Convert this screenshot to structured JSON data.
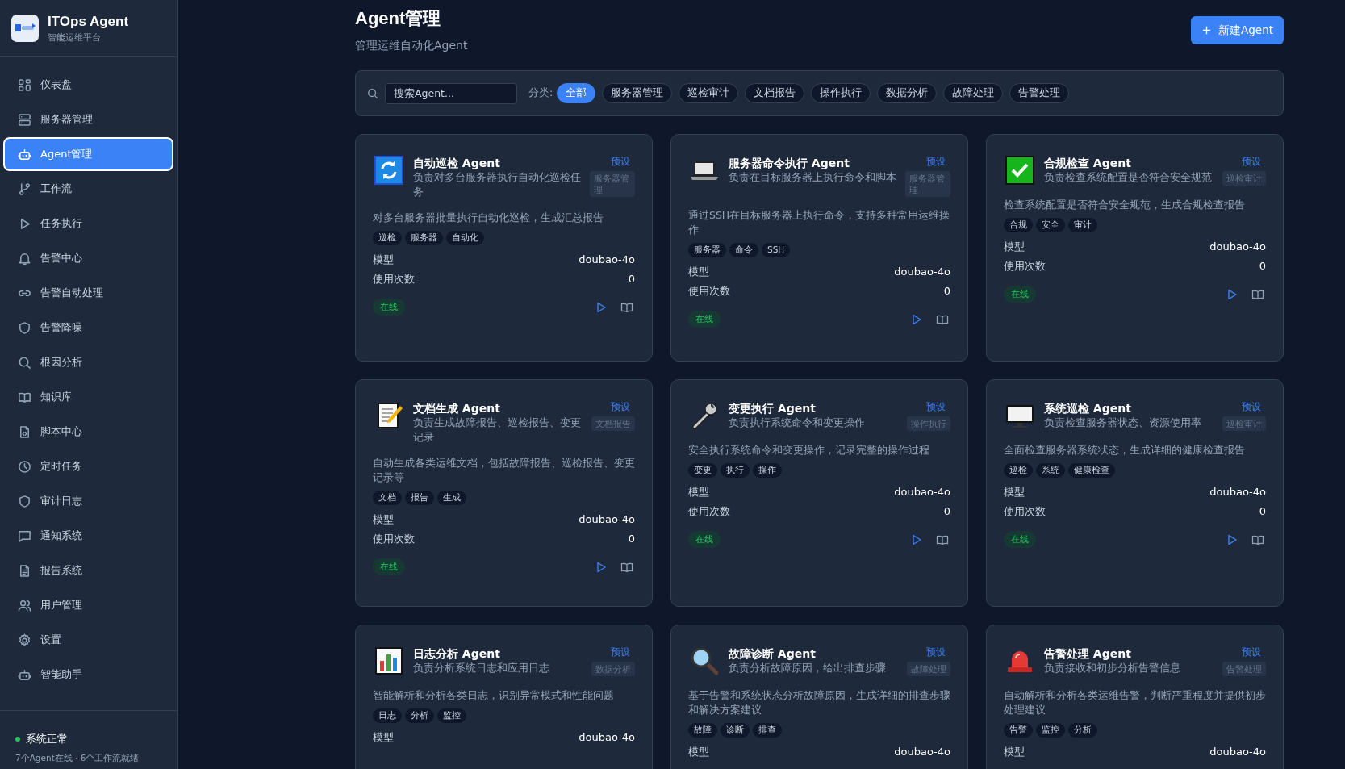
{
  "brand": {
    "title": "ITOps Agent",
    "subtitle": "智能运维平台"
  },
  "nav": [
    {
      "label": "仪表盘",
      "selected": false
    },
    {
      "label": "服务器管理",
      "selected": false
    },
    {
      "label": "Agent管理",
      "selected": true
    },
    {
      "label": "工作流",
      "selected": false
    },
    {
      "label": "任务执行",
      "selected": false
    },
    {
      "label": "告警中心",
      "selected": false
    },
    {
      "label": "告警自动处理",
      "selected": false
    },
    {
      "label": "告警降噪",
      "selected": false
    },
    {
      "label": "根因分析",
      "selected": false
    },
    {
      "label": "知识库",
      "selected": false
    },
    {
      "label": "脚本中心",
      "selected": false
    },
    {
      "label": "定时任务",
      "selected": false
    },
    {
      "label": "审计日志",
      "selected": false
    },
    {
      "label": "通知系统",
      "selected": false
    },
    {
      "label": "报告系统",
      "selected": false
    },
    {
      "label": "用户管理",
      "selected": false
    },
    {
      "label": "设置",
      "selected": false
    },
    {
      "label": "智能助手",
      "selected": false
    }
  ],
  "system_status": {
    "label": "系统正常",
    "detail": "7个Agent在线 · 6个工作流就绪",
    "color": "#22c55e"
  },
  "page": {
    "title": "Agent管理",
    "subtitle": "管理运维自动化Agent",
    "new_button": "新建Agent"
  },
  "filter": {
    "search_placeholder": "搜索Agent...",
    "category_label": "分类:",
    "categories": [
      {
        "label": "全部",
        "selected": true
      },
      {
        "label": "服务器管理",
        "selected": false
      },
      {
        "label": "巡检审计",
        "selected": false
      },
      {
        "label": "文档报告",
        "selected": false
      },
      {
        "label": "操作执行",
        "selected": false
      },
      {
        "label": "数据分析",
        "selected": false
      },
      {
        "label": "故障处理",
        "selected": false
      },
      {
        "label": "告警处理",
        "selected": false
      }
    ]
  },
  "agents": [
    {
      "name": "自动巡检 Agent",
      "summary": "负责对多台服务器执行自动化巡检任务",
      "preset": "预设",
      "category": "服务器管理",
      "description": "对多台服务器批量执行自动化巡检，生成汇总报告",
      "tags": [
        "巡检",
        "服务器",
        "自动化"
      ],
      "stats": [
        {
          "label": "模型",
          "value": "doubao-4o"
        },
        {
          "label": "使用次数",
          "value": "0"
        }
      ],
      "status": "在线"
    },
    {
      "name": "服务器命令执行 Agent",
      "summary": "负责在目标服务器上执行命令和脚本",
      "preset": "预设",
      "category": "服务器管理",
      "description": "通过SSH在目标服务器上执行命令，支持多种常用运维操作",
      "tags": [
        "服务器",
        "命令",
        "SSH"
      ],
      "stats": [
        {
          "label": "模型",
          "value": "doubao-4o"
        },
        {
          "label": "使用次数",
          "value": "0"
        }
      ],
      "status": "在线"
    },
    {
      "name": "合规检查 Agent",
      "summary": "负责检查系统配置是否符合安全规范",
      "preset": "预设",
      "category": "巡检审计",
      "description": "检查系统配置是否符合安全规范，生成合规检查报告",
      "tags": [
        "合规",
        "安全",
        "审计"
      ],
      "stats": [
        {
          "label": "模型",
          "value": "doubao-4o"
        },
        {
          "label": "使用次数",
          "value": "0"
        }
      ],
      "status": "在线"
    },
    {
      "name": "文档生成 Agent",
      "summary": "负责生成故障报告、巡检报告、变更记录",
      "preset": "预设",
      "category": "文档报告",
      "description": "自动生成各类运维文档，包括故障报告、巡检报告、变更记录等",
      "tags": [
        "文档",
        "报告",
        "生成"
      ],
      "stats": [
        {
          "label": "模型",
          "value": "doubao-4o"
        },
        {
          "label": "使用次数",
          "value": "0"
        }
      ],
      "status": "在线"
    },
    {
      "name": "变更执行 Agent",
      "summary": "负责执行系统命令和变更操作",
      "preset": "预设",
      "category": "操作执行",
      "description": "安全执行系统命令和变更操作，记录完整的操作过程",
      "tags": [
        "变更",
        "执行",
        "操作"
      ],
      "stats": [
        {
          "label": "模型",
          "value": "doubao-4o"
        },
        {
          "label": "使用次数",
          "value": "0"
        }
      ],
      "status": "在线"
    },
    {
      "name": "系统巡检 Agent",
      "summary": "负责检查服务器状态、资源使用率",
      "preset": "预设",
      "category": "巡检审计",
      "description": "全面检查服务器系统状态，生成详细的健康检查报告",
      "tags": [
        "巡检",
        "系统",
        "健康检查"
      ],
      "stats": [
        {
          "label": "模型",
          "value": "doubao-4o"
        },
        {
          "label": "使用次数",
          "value": "0"
        }
      ],
      "status": "在线"
    },
    {
      "name": "日志分析 Agent",
      "summary": "负责分析系统日志和应用日志",
      "preset": "预设",
      "category": "数据分析",
      "description": "智能解析和分析各类日志，识别异常模式和性能问题",
      "tags": [
        "日志",
        "分析",
        "监控"
      ],
      "stats": [
        {
          "label": "模型",
          "value": "doubao-4o"
        }
      ]
    },
    {
      "name": "故障诊断 Agent",
      "summary": "负责分析故障原因，给出排查步骤",
      "preset": "预设",
      "category": "故障处理",
      "description": "基于告警和系统状态分析故障原因，生成详细的排查步骤和解决方案建议",
      "tags": [
        "故障",
        "诊断",
        "排查"
      ],
      "stats": [
        {
          "label": "模型",
          "value": "doubao-4o"
        }
      ]
    },
    {
      "name": "告警处理 Agent",
      "summary": "负责接收和初步分析告警信息",
      "preset": "预设",
      "category": "告警处理",
      "description": "自动解析和分析各类运维告警，判断严重程度并提供初步处理建议",
      "tags": [
        "告警",
        "监控",
        "分析"
      ],
      "stats": [
        {
          "label": "模型",
          "value": "doubao-4o"
        }
      ]
    }
  ]
}
